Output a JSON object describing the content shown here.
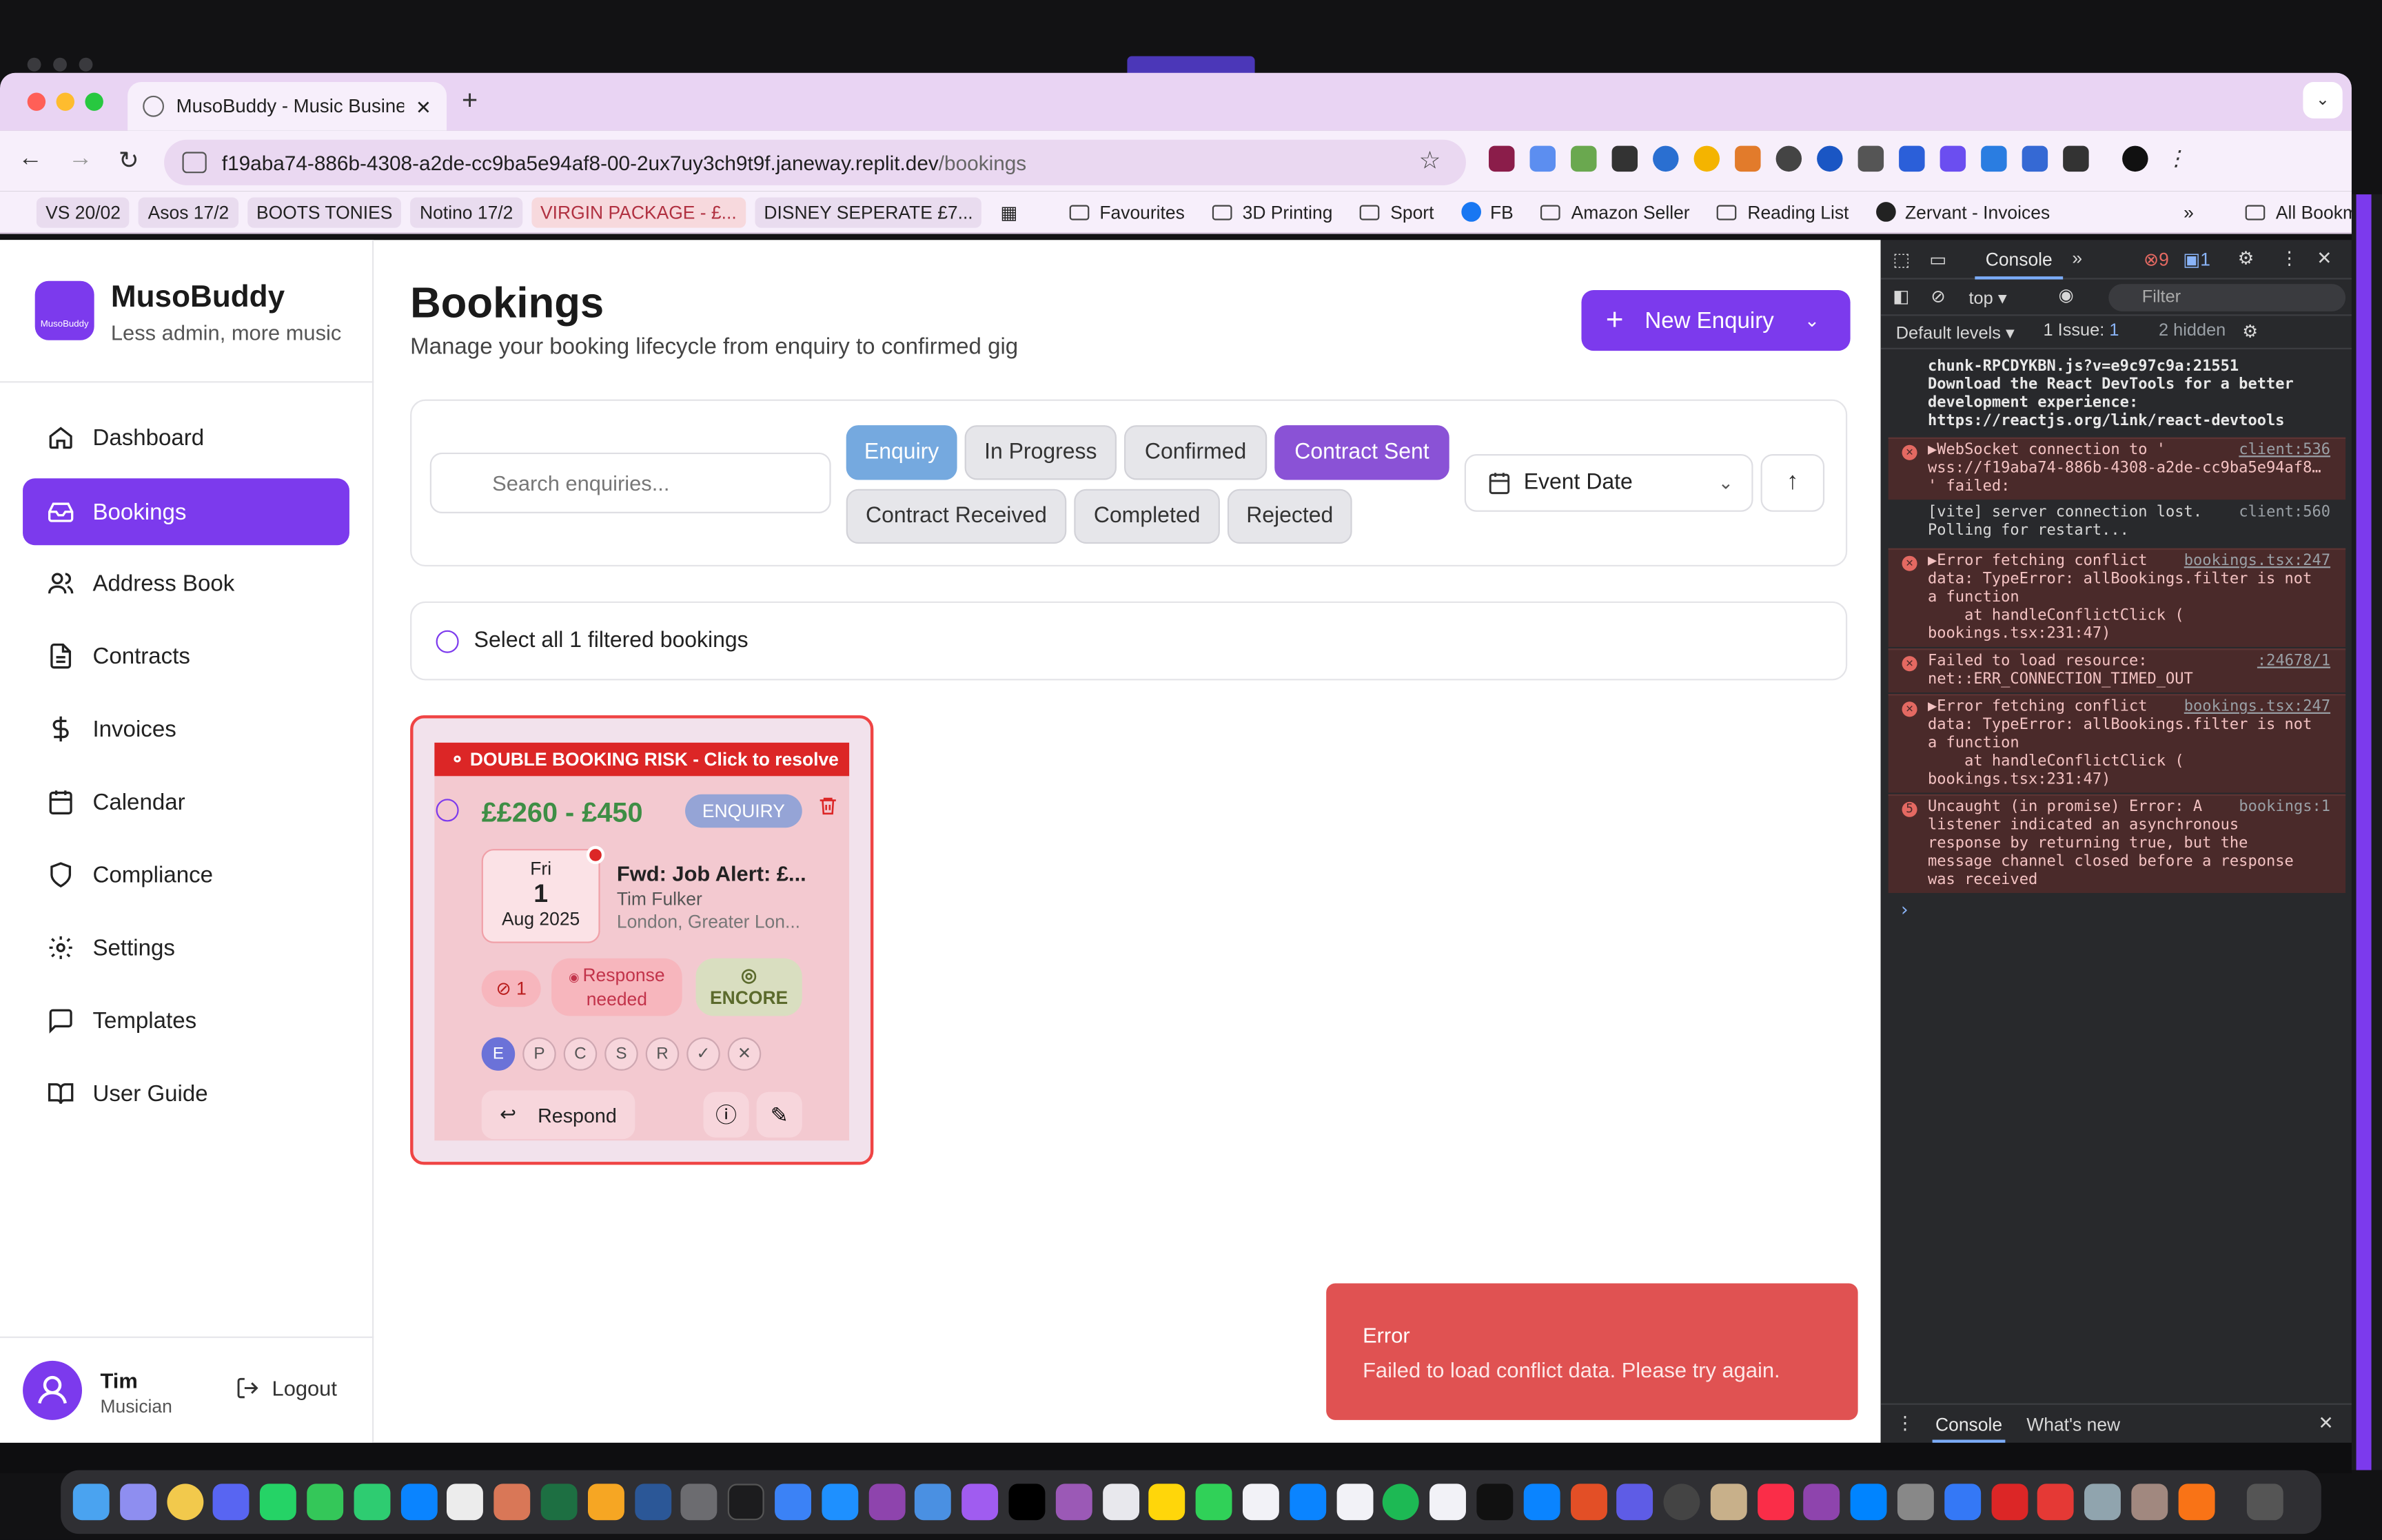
{
  "browser": {
    "tab_title": "MusoBuddy - Music Business",
    "new_tab": "+",
    "url_host": "f19aba74-886b-4308-a2de-cc9ba5e94af8-00-2ux7uy3ch9t9f.janeway.replit.dev",
    "url_path": "/bookings",
    "bookmarks": [
      "VS 20/02",
      "Asos 17/2",
      "BOOTS TONIES",
      "Notino 17/2",
      "VIRGIN PACKAGE - £...",
      "DISNEY SEPERATE £7..."
    ],
    "bookmark_folders": [
      "Favourites",
      "3D Printing",
      "Sport"
    ],
    "bookmark_fb": "FB",
    "bookmark_folders_2": [
      "Amazon Seller",
      "Reading List"
    ],
    "bookmark_zervant": "Zervant - Invoices",
    "all_bookmarks": "All Bookmarks",
    "overflow": "»"
  },
  "sidebar": {
    "logo_text": "MusoBuddy",
    "brand": "MusoBuddy",
    "tagline": "Less admin, more music",
    "items": [
      {
        "label": "Dashboard",
        "icon": "home-icon"
      },
      {
        "label": "Bookings",
        "icon": "inbox-icon"
      },
      {
        "label": "Address Book",
        "icon": "users-icon"
      },
      {
        "label": "Contracts",
        "icon": "file-text-icon"
      },
      {
        "label": "Invoices",
        "icon": "dollar-icon"
      },
      {
        "label": "Calendar",
        "icon": "calendar-icon"
      },
      {
        "label": "Compliance",
        "icon": "shield-icon"
      },
      {
        "label": "Settings",
        "icon": "gear-icon"
      },
      {
        "label": "Templates",
        "icon": "message-square-icon"
      },
      {
        "label": "User Guide",
        "icon": "book-open-icon"
      }
    ],
    "active_index": 1,
    "user": {
      "name": "Tim",
      "role": "Musician"
    },
    "logout": "Logout"
  },
  "main": {
    "title": "Bookings",
    "subtitle": "Manage your booking lifecycle from enquiry to confirmed gig",
    "new_enquiry": "New Enquiry",
    "search_placeholder": "Search enquiries...",
    "status_chips": [
      "Enquiry",
      "In Progress",
      "Confirmed",
      "Contract Sent",
      "Contract Received",
      "Completed",
      "Rejected"
    ],
    "sort_field": "Event Date",
    "select_all": "Select all 1 filtered bookings"
  },
  "booking_card": {
    "risk_banner": "DOUBLE BOOKING RISK - Click to resolve",
    "price": "££260 - £450",
    "status_badge": "ENQUIRY",
    "day": "Fri",
    "date": "1",
    "month_year": "Aug 2025",
    "title": "Fwd: Job Alert: £...",
    "client": "Tim Fulker",
    "location": "London, Greater Lon...",
    "conflicts": "1",
    "response_line1": "Response",
    "response_line2": "needed",
    "encore": "ENCORE",
    "stages": [
      "E",
      "P",
      "C",
      "S",
      "R",
      "✓",
      "✕"
    ],
    "respond": "Respond"
  },
  "toast": {
    "title": "Error",
    "message": "Failed to load conflict data. Please try again."
  },
  "devtools": {
    "tab": "Console",
    "error_count": "9",
    "message_count": "1",
    "context": "top",
    "filter": "Filter",
    "levels": "Default levels",
    "issues": "1 Issue:",
    "issues_count": "1",
    "hidden": "2 hidden",
    "messages": [
      {
        "type": "info",
        "src": "",
        "text": "chunk-RPCDYKBN.js?v=e9c97c9a:21551\nDownload the React DevTools for a better\ndevelopment experience:\nhttps://reactjs.org/link/react-devtools"
      },
      {
        "type": "error",
        "src": "client:536",
        "text": "▶WebSocket connection to '\nwss://f19aba74-886b-4308-a2de-cc9ba5e94af8…\n' failed:"
      },
      {
        "type": "info",
        "src": "client:560",
        "text": "[vite] server connection lost.\nPolling for restart..."
      },
      {
        "type": "error",
        "src": "bookings.tsx:247",
        "text": "▶Error fetching conflict\ndata: TypeError: allBookings.filter is not\na function\n    at handleConflictClick (\nbookings.tsx:231:47)"
      },
      {
        "type": "error",
        "src": ":24678/1",
        "text": "Failed to load resource:\nnet::ERR_CONNECTION_TIMED_OUT"
      },
      {
        "type": "error",
        "src": "bookings.tsx:247",
        "text": "▶Error fetching conflict\ndata: TypeError: allBookings.filter is not\na function\n    at handleConflictClick (\nbookings.tsx:231:47)"
      },
      {
        "type": "error",
        "src": "bookings:1",
        "text": "Uncaught (in promise) Error: A\nlistener indicated an asynchronous\nresponse by returning true, but the\nmessage channel closed before a response\nwas received"
      }
    ],
    "prompt": "›",
    "bottom_tabs": [
      "Console",
      "What's new"
    ]
  },
  "colors": {
    "brand": "#7c3aed",
    "danger": "#dc2626",
    "price_green": "#3e8e45",
    "toast": "#e05252"
  }
}
